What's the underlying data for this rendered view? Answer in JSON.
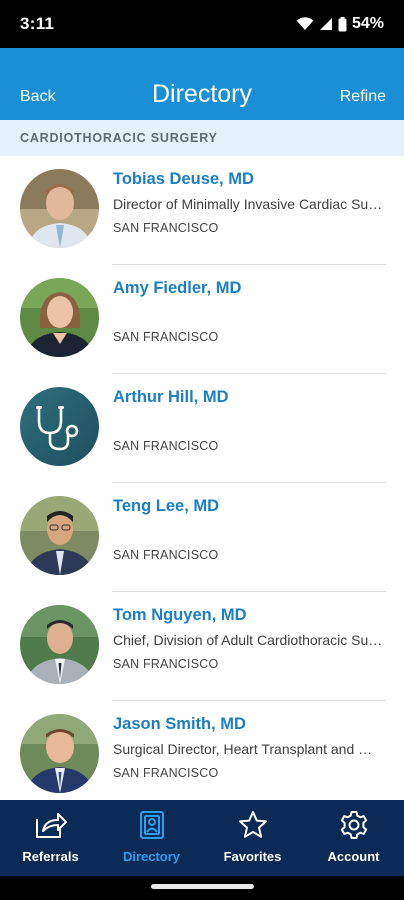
{
  "status_bar": {
    "time": "3:11",
    "battery": "54%"
  },
  "header": {
    "back_label": "Back",
    "title": "Directory",
    "refine_label": "Refine"
  },
  "section": {
    "label": "CARDIOTHORACIC SURGERY"
  },
  "doctors": [
    {
      "name": "Tobias Deuse, MD",
      "subtitle": "Director of Minimally Invasive Cardiac Surgery",
      "location": "SAN FRANCISCO"
    },
    {
      "name": "Amy Fiedler, MD",
      "subtitle": "",
      "location": "SAN FRANCISCO"
    },
    {
      "name": "Arthur Hill, MD",
      "subtitle": "",
      "location": "SAN FRANCISCO"
    },
    {
      "name": "Teng Lee, MD",
      "subtitle": "",
      "location": "SAN FRANCISCO"
    },
    {
      "name": "Tom Nguyen, MD",
      "subtitle": "Chief, Division of Adult Cardiothoracic Surgery",
      "location": "SAN FRANCISCO"
    },
    {
      "name": "Jason Smith, MD",
      "subtitle": "Surgical Director, Heart Transplant and Mechanical Circulatory Support",
      "location": "SAN FRANCISCO"
    }
  ],
  "tabs": [
    {
      "label": "Referrals",
      "icon": "share-icon"
    },
    {
      "label": "Directory",
      "icon": "directory-icon"
    },
    {
      "label": "Favorites",
      "icon": "star-icon"
    },
    {
      "label": "Account",
      "icon": "gear-icon"
    }
  ],
  "colors": {
    "header": "#1b8fd6",
    "tabbar": "#0b2a55",
    "active_tab": "#2d9ff0",
    "name": "#1b7fc4",
    "section_bg": "#e4f1fb"
  }
}
